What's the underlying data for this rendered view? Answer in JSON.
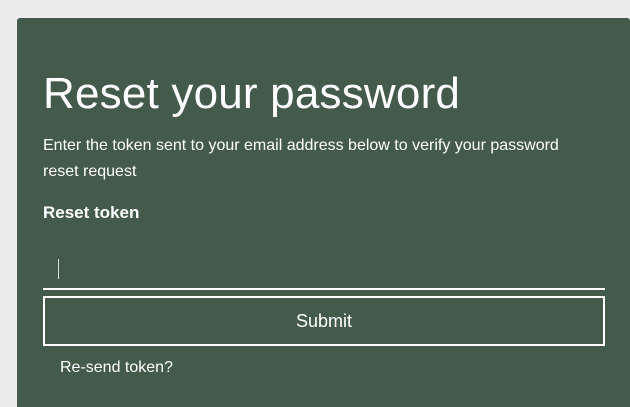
{
  "form": {
    "title": "Reset your password",
    "description": "Enter the token sent to your email address below to verify your password reset request",
    "token_label": "Reset token",
    "token_value": "",
    "submit_label": "Submit",
    "resend_label": "Re-send token?"
  },
  "colors": {
    "card_background": "#445b4c",
    "page_background": "#ececec",
    "text": "#ffffff"
  }
}
